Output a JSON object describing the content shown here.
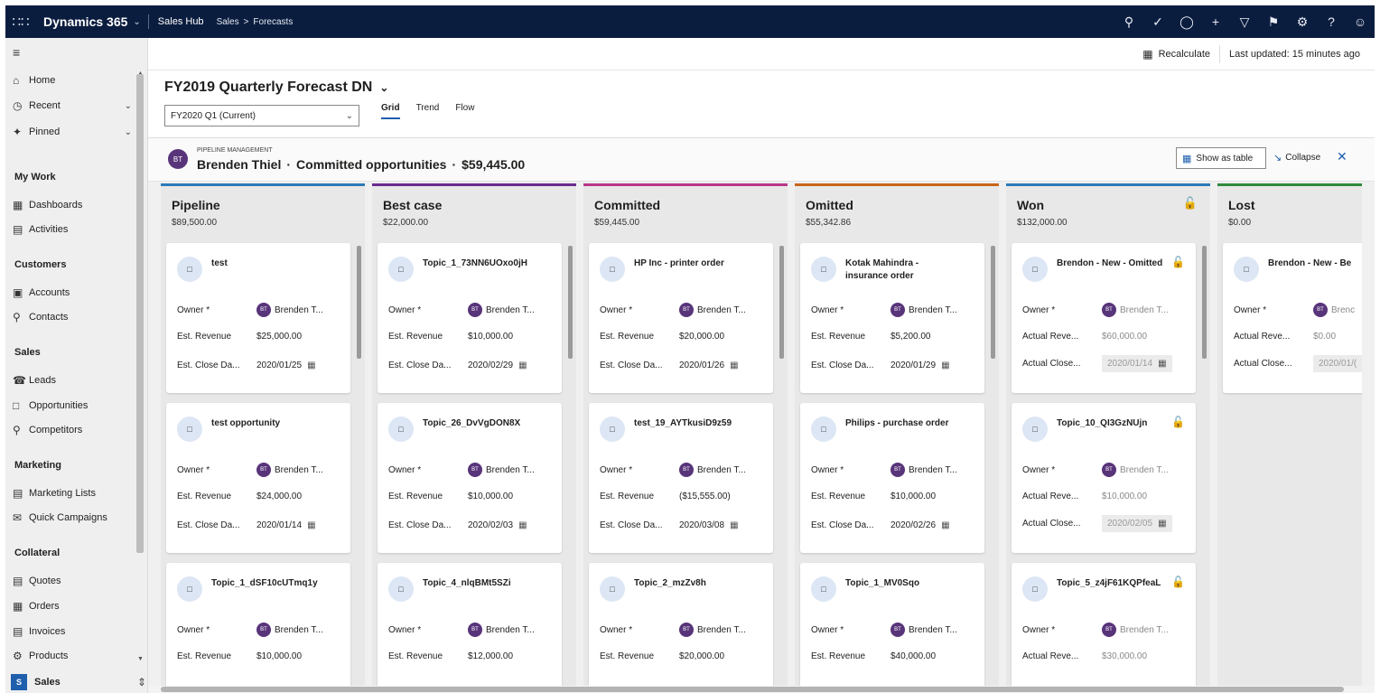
{
  "topbar": {
    "app_name": "Dynamics 365",
    "hub": "Sales Hub",
    "breadcrumb": [
      "Sales",
      "Forecasts"
    ],
    "icons": [
      "search-icon",
      "task-icon",
      "lightbulb-icon",
      "plus-icon",
      "filter-icon",
      "assistant-icon",
      "settings-icon",
      "help-icon",
      "user-icon"
    ]
  },
  "nav": {
    "top_items": [
      {
        "label": "Home",
        "icon": "home-icon"
      },
      {
        "label": "Recent",
        "icon": "clock-icon",
        "chevron": true
      },
      {
        "label": "Pinned",
        "icon": "pin-icon",
        "chevron": true
      }
    ],
    "groups": [
      {
        "title": "My Work",
        "items": [
          {
            "label": "Dashboards"
          },
          {
            "label": "Activities"
          }
        ]
      },
      {
        "title": "Customers",
        "items": [
          {
            "label": "Accounts"
          },
          {
            "label": "Contacts"
          }
        ]
      },
      {
        "title": "Sales",
        "items": [
          {
            "label": "Leads"
          },
          {
            "label": "Opportunities"
          },
          {
            "label": "Competitors"
          }
        ]
      },
      {
        "title": "Marketing",
        "items": [
          {
            "label": "Marketing Lists"
          },
          {
            "label": "Quick Campaigns"
          }
        ]
      },
      {
        "title": "Collateral",
        "items": [
          {
            "label": "Quotes"
          },
          {
            "label": "Orders"
          },
          {
            "label": "Invoices"
          },
          {
            "label": "Products"
          }
        ]
      }
    ],
    "area": {
      "badge": "S",
      "label": "Sales"
    }
  },
  "command_bar": {
    "recalculate": "Recalculate",
    "last_updated": "Last updated: 15 minutes ago"
  },
  "forecast": {
    "title": "FY2019 Quarterly Forecast DN",
    "period": "FY2020 Q1 (Current)",
    "tabs": [
      "Grid",
      "Trend",
      "Flow"
    ],
    "active_tab": "Grid"
  },
  "panel": {
    "kicker": "PIPELINE MANAGEMENT",
    "avatar": "BT",
    "owner": "Brenden Thiel",
    "sep1": "·",
    "subtitle": "Committed opportunities",
    "sep2": "·",
    "amount": "$59,445.00",
    "show_as_table": "Show as table",
    "collapse": "Collapse"
  },
  "columns": [
    {
      "name": "Pipeline",
      "amount": "$89,500.00",
      "color": "#2a7ab8",
      "locked": false,
      "cards": [
        {
          "title": "test",
          "owner_label": "Owner *",
          "owner": "Brenden T...",
          "rev_label": "Est. Revenue",
          "rev": "$25,000.00",
          "date_label": "Est. Close Da...",
          "date": "2020/01/25"
        },
        {
          "title": "test opportunity",
          "owner_label": "Owner *",
          "owner": "Brenden T...",
          "rev_label": "Est. Revenue",
          "rev": "$24,000.00",
          "date_label": "Est. Close Da...",
          "date": "2020/01/14"
        },
        {
          "title": "Topic_1_dSF10cUTmq1y",
          "owner_label": "Owner *",
          "owner": "Brenden T...",
          "rev_label": "Est. Revenue",
          "rev": "$10,000.00"
        }
      ]
    },
    {
      "name": "Best case",
      "amount": "$22,000.00",
      "color": "#6a2c8e",
      "locked": false,
      "cards": [
        {
          "title": "Topic_1_73NN6UOxo0jH",
          "owner_label": "Owner *",
          "owner": "Brenden T...",
          "rev_label": "Est. Revenue",
          "rev": "$10,000.00",
          "date_label": "Est. Close Da...",
          "date": "2020/02/29"
        },
        {
          "title": "Topic_26_DvVgDON8X",
          "owner_label": "Owner *",
          "owner": "Brenden T...",
          "rev_label": "Est. Revenue",
          "rev": "$10,000.00",
          "date_label": "Est. Close Da...",
          "date": "2020/02/03"
        },
        {
          "title": "Topic_4_nlqBMt5SZi",
          "owner_label": "Owner *",
          "owner": "Brenden T...",
          "rev_label": "Est. Revenue",
          "rev": "$12,000.00"
        }
      ]
    },
    {
      "name": "Committed",
      "amount": "$59,445.00",
      "color": "#b8368a",
      "locked": false,
      "cards": [
        {
          "title": "HP Inc - printer order",
          "owner_label": "Owner *",
          "owner": "Brenden T...",
          "rev_label": "Est. Revenue",
          "rev": "$20,000.00",
          "date_label": "Est. Close Da...",
          "date": "2020/01/26"
        },
        {
          "title": "test_19_AYTkusiD9z59",
          "owner_label": "Owner *",
          "owner": "Brenden T...",
          "rev_label": "Est. Revenue",
          "rev": "($15,555.00)",
          "date_label": "Est. Close Da...",
          "date": "2020/03/08"
        },
        {
          "title": "Topic_2_mzZv8h",
          "owner_label": "Owner *",
          "owner": "Brenden T...",
          "rev_label": "Est. Revenue",
          "rev": "$20,000.00"
        }
      ]
    },
    {
      "name": "Omitted",
      "amount": "$55,342.86",
      "color": "#c8651b",
      "locked": false,
      "cards": [
        {
          "title": "Kotak Mahindra - insurance order",
          "owner_label": "Owner *",
          "owner": "Brenden T...",
          "rev_label": "Est. Revenue",
          "rev": "$5,200.00",
          "date_label": "Est. Close Da...",
          "date": "2020/01/29"
        },
        {
          "title": "Philips - purchase order",
          "owner_label": "Owner *",
          "owner": "Brenden T...",
          "rev_label": "Est. Revenue",
          "rev": "$10,000.00",
          "date_label": "Est. Close Da...",
          "date": "2020/02/26"
        },
        {
          "title": "Topic_1_MV0Sqo",
          "owner_label": "Owner *",
          "owner": "Brenden T...",
          "rev_label": "Est. Revenue",
          "rev": "$40,000.00"
        }
      ]
    },
    {
      "name": "Won",
      "amount": "$132,000.00",
      "color": "#2a7ab8",
      "locked": true,
      "cards": [
        {
          "title": "Brendon - New - Omitted",
          "locked": true,
          "owner_label": "Owner *",
          "owner": "Brenden T...",
          "rev_label": "Actual Reve...",
          "rev": "$60,000.00",
          "date_label": "Actual Close...",
          "date": "2020/01/14",
          "readonly": true
        },
        {
          "title": "Topic_10_QI3GzNUjn",
          "locked": true,
          "owner_label": "Owner *",
          "owner": "Brenden T...",
          "rev_label": "Actual Reve...",
          "rev": "$10,000.00",
          "date_label": "Actual Close...",
          "date": "2020/02/05",
          "readonly": true
        },
        {
          "title": "Topic_5_z4jF61KQPfeaL",
          "locked": true,
          "owner_label": "Owner *",
          "owner": "Brenden T...",
          "rev_label": "Actual Reve...",
          "rev": "$30,000.00",
          "readonly": true
        }
      ]
    },
    {
      "name": "Lost",
      "amount": "$0.00",
      "color": "#2f8a3a",
      "locked": false,
      "cards": [
        {
          "title": "Brendon - New - Be",
          "owner_label": "Owner *",
          "owner": "Brenc",
          "rev_label": "Actual Reve...",
          "rev": "$0.00",
          "date_label": "Actual Close...",
          "date": "2020/01/(",
          "readonly": true
        }
      ]
    }
  ]
}
